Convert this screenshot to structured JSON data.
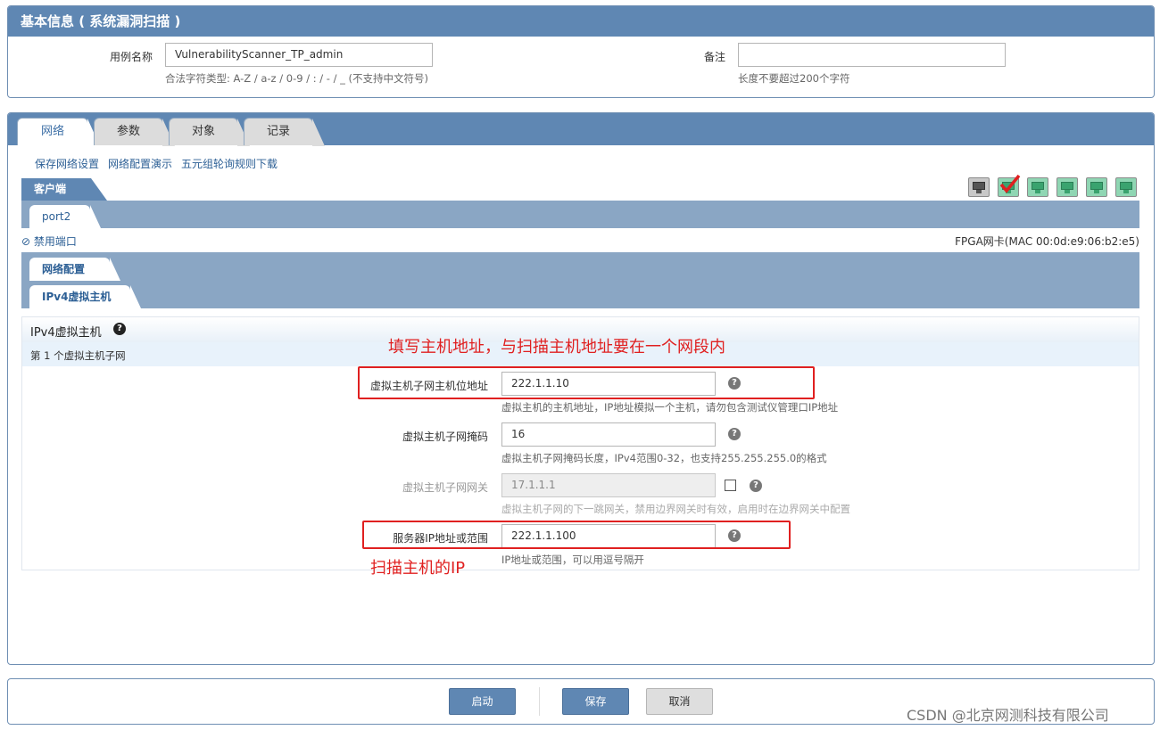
{
  "basic_info": {
    "title": "基本信息 ( 系统漏洞扫描 )",
    "case_name_label": "用例名称",
    "case_name_value": "VulnerabilityScanner_TP_admin",
    "case_name_hint": "合法字符类型: A-Z / a-z / 0-9 / : / - / _ (不支持中文符号)",
    "remark_label": "备注",
    "remark_value": "",
    "remark_hint": "长度不要超过200个字符"
  },
  "tabs": [
    {
      "label": "网络",
      "active": true
    },
    {
      "label": "参数",
      "active": false
    },
    {
      "label": "对象",
      "active": false
    },
    {
      "label": "记录",
      "active": false
    }
  ],
  "actions": {
    "save_network": "保存网络设置",
    "network_demo": "网络配置演示",
    "five_tuple_download": "五元组轮询规则下载"
  },
  "client_tab": "客户端",
  "port_tab": "port2",
  "disable_port": "禁用端口",
  "fpga_info": "FPGA网卡(MAC 00:0d:e9:06:b2:e5)",
  "port_icons": [
    "network-port-gray",
    "network-port-selected",
    "network-port",
    "network-port",
    "network-port",
    "network-port"
  ],
  "network_config_tab": "网络配置",
  "ipv4_host_tab": "IPv4虚拟主机",
  "section": {
    "title": "IPv4虚拟主机",
    "subnet_title": "第 1 个虚拟主机子网"
  },
  "fields": {
    "host_ip": {
      "label": "虚拟主机子网主机位地址",
      "value": "222.1.1.10",
      "hint": "虚拟主机的主机地址，IP地址模拟一个主机，请勿包含测试仪管理口IP地址"
    },
    "mask": {
      "label": "虚拟主机子网掩码",
      "value": "16",
      "hint": "虚拟主机子网掩码长度，IPv4范围0-32，也支持255.255.255.0的格式"
    },
    "gateway": {
      "label": "虚拟主机子网网关",
      "value": "17.1.1.1",
      "hint": "虚拟主机子网的下一跳网关，禁用边界网关时有效，启用时在边界网关中配置"
    },
    "server_ip": {
      "label": "服务器IP地址或范围",
      "value": "222.1.1.100",
      "hint": "IP地址或范围，可以用逗号隔开"
    }
  },
  "annotations": {
    "top": "填写主机地址，与扫描主机地址要在一个网段内",
    "bottom": "扫描主机的IP"
  },
  "buttons": {
    "start": "启动",
    "save": "保存",
    "cancel": "取消"
  },
  "watermark": "CSDN @北京网测科技有限公司",
  "colors": {
    "header_blue": "#5f87b3",
    "annotation_red": "#e02020",
    "link_blue": "#2c5f95"
  }
}
